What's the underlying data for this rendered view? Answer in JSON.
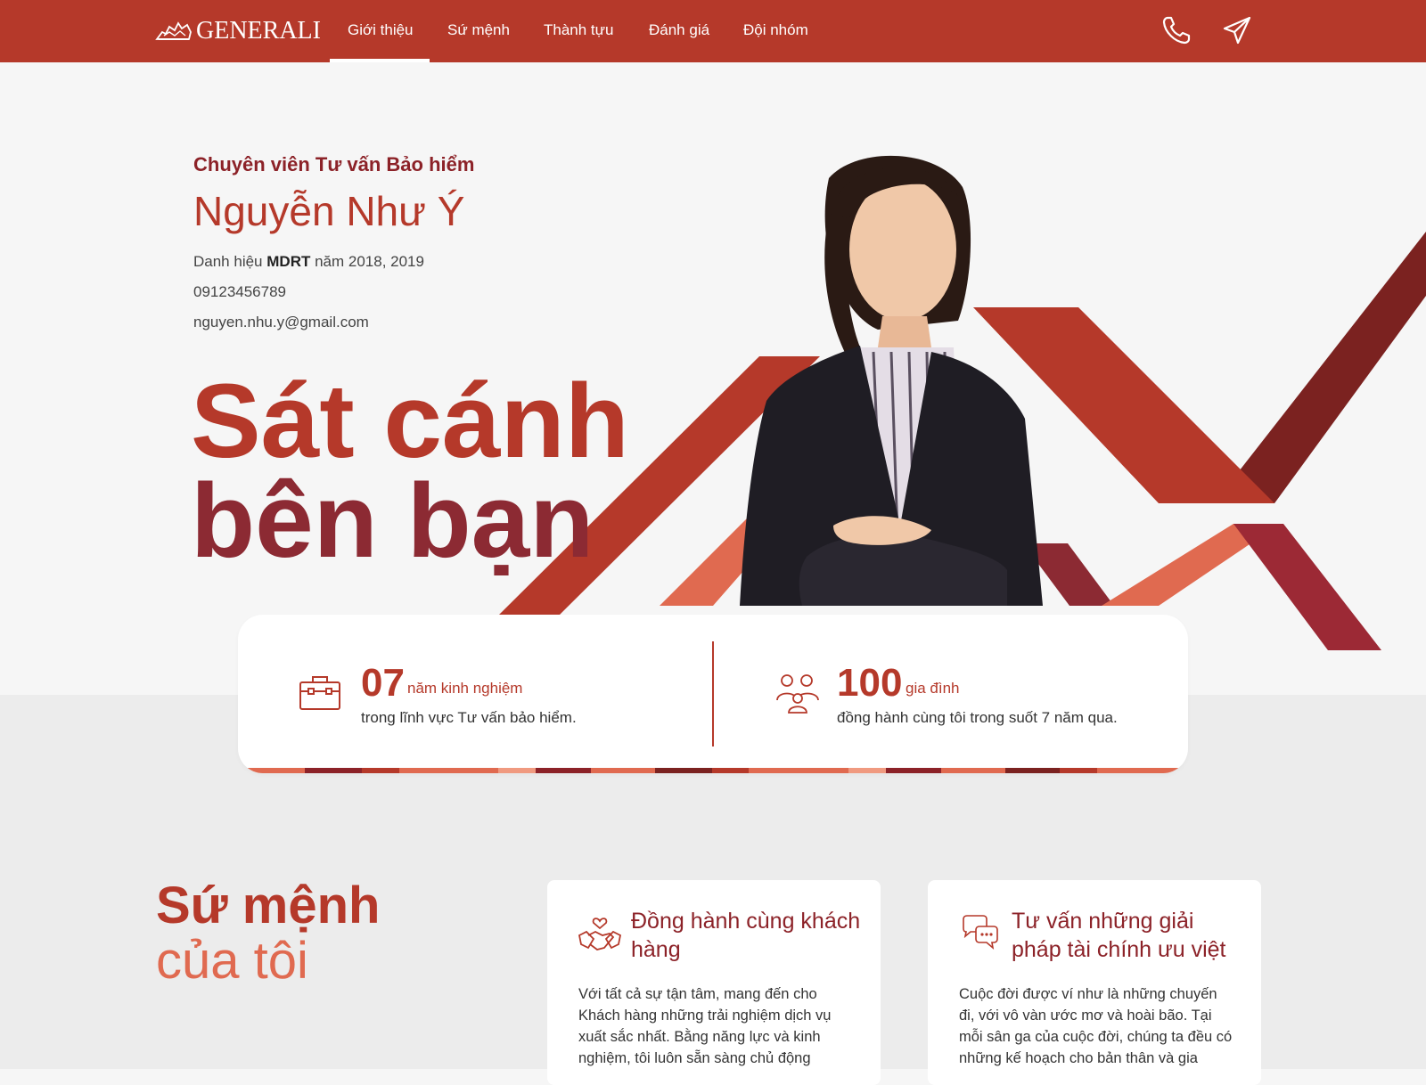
{
  "nav": {
    "brand": "GENERALI",
    "links": [
      "Giới thiệu",
      "Sứ mệnh",
      "Thành tựu",
      "Đánh giá",
      "Đội nhóm"
    ],
    "active": "Giới thiệu",
    "icons": [
      "phone-icon",
      "send-icon"
    ]
  },
  "hero": {
    "subtitle": "Chuyên viên Tư vấn Bảo hiểm",
    "name": "Nguyễn Như Ý",
    "award_prefix": "Danh hiệu",
    "award_bold": "MDRT",
    "award_suffix": "năm 2018, 2019",
    "phone": "09123456789",
    "email": "nguyen.nhu.y@gmail.com",
    "slogan_line1": "Sát cánh",
    "slogan_line2": "bên bạn"
  },
  "stats": [
    {
      "number": "07",
      "unit": "năm kinh nghiệm",
      "desc": "trong lĩnh vực Tư vấn bảo hiểm.",
      "icon": "briefcase-icon"
    },
    {
      "number": "100",
      "unit": "gia đình",
      "desc": "đồng hành cùng tôi trong suốt 7 năm qua.",
      "icon": "family-icon"
    }
  ],
  "mission": {
    "title_line1": "Sứ mệnh",
    "title_line2": "của tôi",
    "cards": [
      {
        "title": "Đồng hành cùng khách hàng",
        "body": "Với tất cả sự tận tâm, mang đến cho Khách hàng những trải nghiệm dịch vụ xuất sắc nhất. Bằng năng lực và kinh nghiệm, tôi luôn sẵn sàng chủ động",
        "icon": "handshake-heart-icon"
      },
      {
        "title": "Tư vấn những giải pháp tài chính ưu việt",
        "body": "Cuộc đời được ví như là những chuyến đi, với vô vàn ước mơ và hoài bão. Tại mỗi sân ga của cuộc đời, chúng ta đều có những kế hoạch cho bản thân và gia",
        "icon": "chat-bubbles-icon"
      }
    ]
  },
  "colors": {
    "primary": "#b5392a",
    "dark_red": "#8c2228",
    "coral": "#e06a50",
    "page_bg": "#f6f6f6"
  }
}
